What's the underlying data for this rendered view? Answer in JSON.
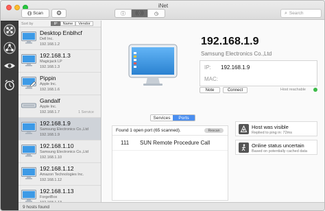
{
  "window": {
    "title": "iNet"
  },
  "toolbar": {
    "scan_label": "Scan",
    "search_placeholder": "Search"
  },
  "sortbar": {
    "label": "Sort by",
    "options": [
      "IP",
      "Name",
      "Vendor"
    ],
    "active": "IP"
  },
  "hosts": [
    {
      "name": "Desktop Enblhcf",
      "vendor": "Dell Inc.",
      "ip": "192.168.1.2",
      "services": "",
      "icon": "monitor-icon",
      "selected": false
    },
    {
      "name": "192.168.1.3",
      "vendor": "Magicjack LP",
      "ip": "192.168.1.3",
      "services": "",
      "icon": "monitor-icon",
      "selected": false
    },
    {
      "name": "Pippin",
      "vendor": "Apple Inc.",
      "ip": "192.168.1.6",
      "services": "",
      "icon": "pencil-monitor-icon",
      "selected": false
    },
    {
      "name": "Gandalf",
      "vendor": "Apple Inc.",
      "ip": "192.168.1.7",
      "services": "1 Service",
      "icon": "mac-mini-icon",
      "selected": false
    },
    {
      "name": "192.168.1.9",
      "vendor": "Samsung Electronics Co.,Ltd",
      "ip": "192.168.1.9",
      "services": "",
      "icon": "monitor-icon",
      "selected": true
    },
    {
      "name": "192.168.1.10",
      "vendor": "Samsung Electronics Co.,Ltd",
      "ip": "192.168.1.10",
      "services": "",
      "icon": "monitor-icon",
      "selected": false
    },
    {
      "name": "192.168.1.12",
      "vendor": "Amazon Technologies Inc.",
      "ip": "192.168.1.12",
      "services": "",
      "icon": "monitor-icon",
      "selected": false
    },
    {
      "name": "192.168.1.13",
      "vendor": "ForgetBox",
      "ip": "192.168.1.13",
      "services": "",
      "icon": "monitor-icon",
      "selected": false
    }
  ],
  "status": {
    "hosts_found": "9 hosts found"
  },
  "detail": {
    "title": "192.168.1.9",
    "vendor": "Samsung Electronics Co.,Ltd",
    "ip_label": "IP:",
    "ip_value": "192.168.1.9",
    "mac_label": "MAC:",
    "mac_value": "",
    "note_label": "Note",
    "connect_label": "Connect",
    "reachable_label": "Host reachable",
    "reachable_color": "#3dbb49"
  },
  "tabs": {
    "services": "Services",
    "ports": "Ports",
    "active": "Ports"
  },
  "ports": {
    "summary": "Found 1 open port (65 scanned).",
    "rescan_label": "Rescan",
    "rows": [
      {
        "port": "111",
        "service": "SUN Remote Procedure Call"
      }
    ]
  },
  "cards": [
    {
      "title": "Host was visible",
      "subtitle": "Replied to ping in: 72ms",
      "icon": "ping-icon"
    },
    {
      "title": "Online status uncertain",
      "subtitle": "Based on potentially cached data",
      "icon": "walking-person-icon"
    }
  ],
  "colors": {
    "accent": "#4a8ef0",
    "rail": "#3a3a3a",
    "selection": "#cfd3d9"
  }
}
